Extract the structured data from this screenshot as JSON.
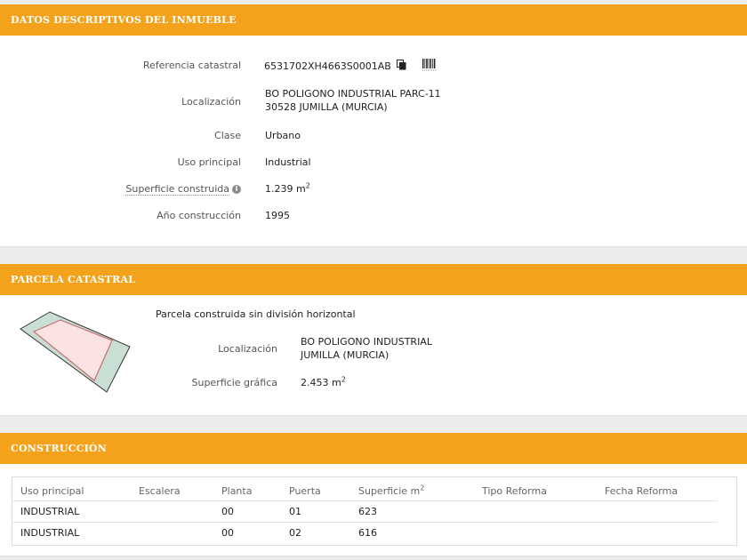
{
  "datos": {
    "header": "DATOS DESCRIPTIVOS DEL INMUEBLE",
    "rows": {
      "referencia": {
        "label": "Referencia catastral",
        "value": "6531702XH4663S0001AB"
      },
      "localizacion": {
        "label": "Localización",
        "line1": "BO POLIGONO INDUSTRIAL PARC-11",
        "line2": "30528 JUMILLA (MURCIA)"
      },
      "clase": {
        "label": "Clase",
        "value": "Urbano"
      },
      "uso": {
        "label": "Uso principal",
        "value": "Industrial"
      },
      "superficie": {
        "label": "Superficie construida",
        "value": "1.239 m",
        "unit_sup": "2"
      },
      "anio": {
        "label": "Año construcción",
        "value": "1995"
      }
    }
  },
  "parcela": {
    "header": "PARCELA CATASTRAL",
    "description": "Parcela construida sin división horizontal",
    "localizacion": {
      "label": "Localización",
      "line1": "BO POLIGONO INDUSTRIAL",
      "line2": "JUMILLA (MURCIA)"
    },
    "superficie": {
      "label": "Superficie gráfica",
      "value": "2.453 m",
      "unit_sup": "2"
    }
  },
  "construccion": {
    "header": "CONSTRUCCIÓN",
    "columns": [
      "Uso principal",
      "Escalera",
      "Planta",
      "Puerta",
      "Superficie m",
      "Tipo Reforma",
      "Fecha Reforma"
    ],
    "superficie_sup": "2",
    "rows": [
      [
        "INDUSTRIAL",
        "",
        "00",
        "01",
        "623",
        "",
        ""
      ],
      [
        "INDUSTRIAL",
        "",
        "00",
        "02",
        "616",
        "",
        ""
      ]
    ]
  },
  "colors": {
    "accent": "#f4a21c",
    "parcel_fill": "#c9dfd3",
    "building_fill": "#fbe3e3",
    "building_stroke": "#c87070"
  }
}
